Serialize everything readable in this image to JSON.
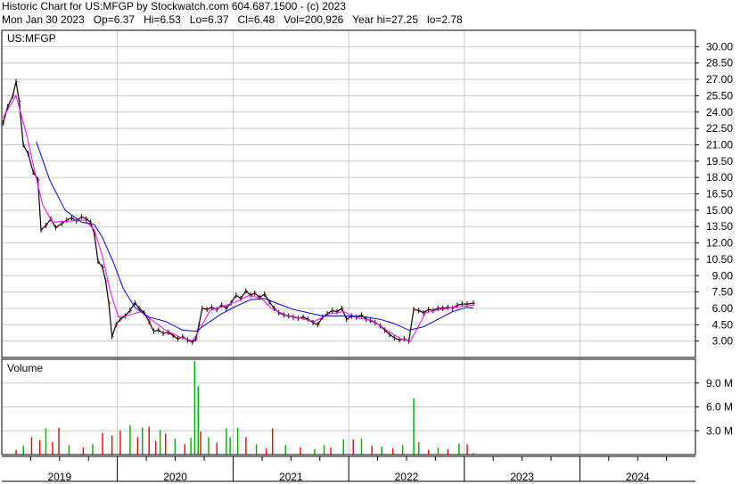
{
  "header": {
    "line1": "Historic Chart for US:MFGP by Stockwatch.com 604.687.1500 - (c) 2023",
    "line2": "Mon Jan 30 2023   Op=6.37   Hi=6.53   Lo=6.37   Cl=6.48   Vol=200,926   Year hi=27.25   lo=2.78"
  },
  "chart_data": [
    {
      "type": "line",
      "title": "US:MFGP",
      "y_scale": "linear",
      "ylim": [
        1.5,
        31.5
      ],
      "ytick_labels": [
        "30.00",
        "28.50",
        "27.00",
        "25.50",
        "24.00",
        "22.50",
        "21.00",
        "19.50",
        "18.00",
        "16.50",
        "15.00",
        "13.50",
        "12.00",
        "10.50",
        "9.00",
        "7.50",
        "6.00",
        "4.50",
        "3.00"
      ],
      "xlim": [
        "2019-01-01",
        "2024-12-31"
      ],
      "xtick_labels": [
        "2019",
        "2020",
        "2021",
        "2022",
        "2023",
        "2024"
      ],
      "grid": true,
      "colors": {
        "price": "#000000",
        "ma_short": "#ff00ff",
        "ma_long": "#0000cc",
        "grid": "#c8c8c8"
      },
      "series": [
        {
          "style": "price",
          "points": [
            [
              "2019-01-05",
              23.0
            ],
            [
              "2019-01-20",
              24.5
            ],
            [
              "2019-02-05",
              25.5
            ],
            [
              "2019-02-15",
              26.8
            ],
            [
              "2019-02-25",
              25.0
            ],
            [
              "2019-03-10",
              21.0
            ],
            [
              "2019-03-25",
              20.2
            ],
            [
              "2019-04-10",
              18.5
            ],
            [
              "2019-04-25",
              17.8
            ],
            [
              "2019-05-05",
              13.2
            ],
            [
              "2019-05-20",
              13.6
            ],
            [
              "2019-06-05",
              14.2
            ],
            [
              "2019-06-20",
              13.4
            ],
            [
              "2019-07-10",
              13.8
            ],
            [
              "2019-07-25",
              14.1
            ],
            [
              "2019-08-10",
              14.3
            ],
            [
              "2019-08-25",
              14.0
            ],
            [
              "2019-09-10",
              14.4
            ],
            [
              "2019-09-25",
              14.2
            ],
            [
              "2019-10-08",
              13.9
            ],
            [
              "2019-10-20",
              12.9
            ],
            [
              "2019-11-01",
              10.3
            ],
            [
              "2019-11-15",
              9.8
            ],
            [
              "2019-11-25",
              8.5
            ],
            [
              "2019-12-05",
              6.5
            ],
            [
              "2019-12-15",
              3.4
            ],
            [
              "2019-12-28",
              4.5
            ],
            [
              "2020-01-10",
              5.0
            ],
            [
              "2020-01-25",
              5.3
            ],
            [
              "2020-02-10",
              5.8
            ],
            [
              "2020-02-25",
              6.5
            ],
            [
              "2020-03-10",
              6.0
            ],
            [
              "2020-03-25",
              5.6
            ],
            [
              "2020-04-10",
              4.8
            ],
            [
              "2020-04-25",
              3.9
            ],
            [
              "2020-05-10",
              4.0
            ],
            [
              "2020-05-25",
              3.7
            ],
            [
              "2020-06-10",
              3.8
            ],
            [
              "2020-06-25",
              3.5
            ],
            [
              "2020-07-10",
              3.2
            ],
            [
              "2020-07-25",
              3.4
            ],
            [
              "2020-08-10",
              3.1
            ],
            [
              "2020-08-25",
              2.9
            ],
            [
              "2020-09-05",
              3.2
            ],
            [
              "2020-09-15",
              4.5
            ],
            [
              "2020-09-25",
              6.0
            ],
            [
              "2020-10-10",
              5.9
            ],
            [
              "2020-10-25",
              6.1
            ],
            [
              "2020-11-10",
              5.9
            ],
            [
              "2020-11-25",
              6.3
            ],
            [
              "2020-12-10",
              6.0
            ],
            [
              "2020-12-25",
              6.5
            ],
            [
              "2021-01-10",
              7.2
            ],
            [
              "2021-01-25",
              6.9
            ],
            [
              "2021-02-10",
              7.6
            ],
            [
              "2021-02-25",
              7.2
            ],
            [
              "2021-03-10",
              7.4
            ],
            [
              "2021-03-25",
              7.0
            ],
            [
              "2021-04-10",
              7.3
            ],
            [
              "2021-04-25",
              6.6
            ],
            [
              "2021-05-10",
              6.0
            ],
            [
              "2021-05-25",
              5.6
            ],
            [
              "2021-06-10",
              5.4
            ],
            [
              "2021-06-25",
              5.3
            ],
            [
              "2021-07-10",
              5.2
            ],
            [
              "2021-07-25",
              5.1
            ],
            [
              "2021-08-10",
              5.2
            ],
            [
              "2021-08-25",
              5.0
            ],
            [
              "2021-09-10",
              4.7
            ],
            [
              "2021-09-25",
              4.5
            ],
            [
              "2021-10-10",
              5.2
            ],
            [
              "2021-10-25",
              5.5
            ],
            [
              "2021-11-10",
              5.8
            ],
            [
              "2021-11-25",
              5.7
            ],
            [
              "2021-12-10",
              6.0
            ],
            [
              "2021-12-25",
              5.0
            ],
            [
              "2022-01-10",
              5.3
            ],
            [
              "2022-01-25",
              5.2
            ],
            [
              "2022-02-10",
              5.4
            ],
            [
              "2022-02-25",
              5.0
            ],
            [
              "2022-03-10",
              4.9
            ],
            [
              "2022-03-25",
              4.7
            ],
            [
              "2022-04-10",
              4.4
            ],
            [
              "2022-04-25",
              4.0
            ],
            [
              "2022-05-10",
              3.6
            ],
            [
              "2022-05-25",
              3.3
            ],
            [
              "2022-06-10",
              3.1
            ],
            [
              "2022-06-25",
              3.2
            ],
            [
              "2022-07-10",
              3.0
            ],
            [
              "2022-07-25",
              5.9
            ],
            [
              "2022-08-10",
              5.8
            ],
            [
              "2022-08-25",
              5.6
            ],
            [
              "2022-09-10",
              5.9
            ],
            [
              "2022-09-25",
              5.8
            ],
            [
              "2022-10-10",
              6.0
            ],
            [
              "2022-10-25",
              6.0
            ],
            [
              "2022-11-10",
              6.1
            ],
            [
              "2022-11-25",
              6.0
            ],
            [
              "2022-12-10",
              6.3
            ],
            [
              "2022-12-25",
              6.4
            ],
            [
              "2023-01-10",
              6.4
            ],
            [
              "2023-01-30",
              6.48
            ]
          ]
        },
        {
          "style": "ma_short",
          "points": [
            [
              "2019-01-05",
              23.5
            ],
            [
              "2019-02-15",
              25.5
            ],
            [
              "2019-03-20",
              22.0
            ],
            [
              "2019-04-15",
              18.6
            ],
            [
              "2019-05-10",
              15.5
            ],
            [
              "2019-06-10",
              13.9
            ],
            [
              "2019-08-01",
              14.0
            ],
            [
              "2019-09-20",
              14.1
            ],
            [
              "2019-10-20",
              13.2
            ],
            [
              "2019-11-15",
              10.8
            ],
            [
              "2019-12-10",
              7.5
            ],
            [
              "2020-01-05",
              5.2
            ],
            [
              "2020-02-10",
              5.4
            ],
            [
              "2020-03-15",
              5.7
            ],
            [
              "2020-04-20",
              4.9
            ],
            [
              "2020-06-01",
              4.0
            ],
            [
              "2020-07-15",
              3.4
            ],
            [
              "2020-08-25",
              3.0
            ],
            [
              "2020-09-20",
              4.2
            ],
            [
              "2020-10-20",
              5.8
            ],
            [
              "2020-12-01",
              6.2
            ],
            [
              "2021-01-10",
              6.6
            ],
            [
              "2021-02-20",
              7.2
            ],
            [
              "2021-04-01",
              6.9
            ],
            [
              "2021-05-01",
              6.0
            ],
            [
              "2021-06-15",
              5.4
            ],
            [
              "2021-08-01",
              5.1
            ],
            [
              "2021-09-15",
              4.8
            ],
            [
              "2021-11-01",
              5.5
            ],
            [
              "2021-12-15",
              5.7
            ],
            [
              "2022-02-01",
              5.1
            ],
            [
              "2022-03-15",
              4.9
            ],
            [
              "2022-05-01",
              4.0
            ],
            [
              "2022-06-15",
              3.2
            ],
            [
              "2022-07-15",
              3.0
            ],
            [
              "2022-09-01",
              5.6
            ],
            [
              "2022-10-15",
              5.9
            ],
            [
              "2022-12-01",
              6.1
            ],
            [
              "2023-01-30",
              6.3
            ]
          ]
        },
        {
          "style": "ma_long",
          "points": [
            [
              "2019-04-20",
              21.3
            ],
            [
              "2019-06-01",
              17.8
            ],
            [
              "2019-07-20",
              15.0
            ],
            [
              "2019-09-10",
              13.9
            ],
            [
              "2019-10-20",
              13.7
            ],
            [
              "2019-11-15",
              12.5
            ],
            [
              "2019-12-20",
              10.2
            ],
            [
              "2020-01-20",
              7.8
            ],
            [
              "2020-02-25",
              6.1
            ],
            [
              "2020-04-10",
              5.2
            ],
            [
              "2020-06-01",
              4.8
            ],
            [
              "2020-07-25",
              4.0
            ],
            [
              "2020-09-05",
              3.9
            ],
            [
              "2020-10-10",
              4.6
            ],
            [
              "2020-11-25",
              5.5
            ],
            [
              "2021-01-10",
              6.2
            ],
            [
              "2021-02-25",
              6.8
            ],
            [
              "2021-04-10",
              6.9
            ],
            [
              "2021-05-25",
              6.4
            ],
            [
              "2021-07-10",
              5.9
            ],
            [
              "2021-08-25",
              5.6
            ],
            [
              "2021-10-10",
              5.3
            ],
            [
              "2021-11-25",
              5.3
            ],
            [
              "2022-01-10",
              5.3
            ],
            [
              "2022-02-25",
              5.2
            ],
            [
              "2022-04-10",
              5.0
            ],
            [
              "2022-05-25",
              4.6
            ],
            [
              "2022-07-10",
              4.0
            ],
            [
              "2022-08-25",
              4.3
            ],
            [
              "2022-10-10",
              5.0
            ],
            [
              "2022-11-25",
              5.7
            ],
            [
              "2023-01-10",
              6.1
            ],
            [
              "2023-01-30",
              6.0
            ]
          ]
        }
      ]
    },
    {
      "type": "bar",
      "title": "Volume",
      "ylim": [
        0,
        12.0
      ],
      "ytick_labels": [
        "9.0 M",
        "6.0 M",
        "3.0 M"
      ],
      "xlim": [
        "2019-01-01",
        "2024-12-31"
      ],
      "grid": true,
      "colors": {
        "up": "#00aa00",
        "down": "#ee0000"
      },
      "values_millions": [
        [
          "2019-02-15",
          0.6,
          "down"
        ],
        [
          "2019-03-10",
          1.1,
          "up"
        ],
        [
          "2019-04-05",
          2.2,
          "down"
        ],
        [
          "2019-05-01",
          1.8,
          "down"
        ],
        [
          "2019-05-20",
          3.3,
          "up"
        ],
        [
          "2019-06-10",
          1.6,
          "down"
        ],
        [
          "2019-06-30",
          3.4,
          "down"
        ],
        [
          "2019-08-01",
          1.2,
          "up"
        ],
        [
          "2019-09-15",
          0.9,
          "down"
        ],
        [
          "2019-10-15",
          1.3,
          "up"
        ],
        [
          "2019-11-15",
          2.7,
          "down"
        ],
        [
          "2019-12-15",
          2.4,
          "down"
        ],
        [
          "2020-01-10",
          3.0,
          "down"
        ],
        [
          "2020-02-10",
          3.7,
          "up"
        ],
        [
          "2020-03-05",
          2.2,
          "down"
        ],
        [
          "2020-03-20",
          3.4,
          "up"
        ],
        [
          "2020-04-10",
          3.5,
          "down"
        ],
        [
          "2020-05-01",
          1.7,
          "down"
        ],
        [
          "2020-05-15",
          3.1,
          "up"
        ],
        [
          "2020-06-01",
          2.6,
          "down"
        ],
        [
          "2020-07-01",
          2.0,
          "up"
        ],
        [
          "2020-08-01",
          1.3,
          "down"
        ],
        [
          "2020-08-20",
          2.1,
          "up"
        ],
        [
          "2020-09-01",
          11.8,
          "up"
        ],
        [
          "2020-09-12",
          8.6,
          "up"
        ],
        [
          "2020-09-20",
          2.9,
          "down"
        ],
        [
          "2020-10-15",
          2.2,
          "up"
        ],
        [
          "2020-11-10",
          1.5,
          "down"
        ],
        [
          "2020-12-10",
          3.3,
          "up"
        ],
        [
          "2020-12-22",
          2.2,
          "up"
        ],
        [
          "2021-01-15",
          3.4,
          "up"
        ],
        [
          "2021-02-10",
          2.2,
          "down"
        ],
        [
          "2021-03-15",
          1.3,
          "up"
        ],
        [
          "2021-04-15",
          0.8,
          "down"
        ],
        [
          "2021-05-05",
          3.3,
          "down"
        ],
        [
          "2021-06-15",
          1.2,
          "up"
        ],
        [
          "2021-08-01",
          0.9,
          "down"
        ],
        [
          "2021-09-15",
          0.7,
          "up"
        ],
        [
          "2021-10-15",
          1.2,
          "up"
        ],
        [
          "2021-11-05",
          0.9,
          "down"
        ],
        [
          "2021-12-15",
          1.9,
          "up"
        ],
        [
          "2022-01-15",
          1.9,
          "down"
        ],
        [
          "2022-02-10",
          2.0,
          "up"
        ],
        [
          "2022-03-15",
          1.1,
          "down"
        ],
        [
          "2022-04-15",
          1.0,
          "up"
        ],
        [
          "2022-05-20",
          0.8,
          "down"
        ],
        [
          "2022-06-20",
          1.2,
          "up"
        ],
        [
          "2022-07-25",
          7.1,
          "up"
        ],
        [
          "2022-08-10",
          1.6,
          "up"
        ],
        [
          "2022-09-10",
          0.6,
          "down"
        ],
        [
          "2022-10-10",
          0.9,
          "up"
        ],
        [
          "2022-11-10",
          0.7,
          "down"
        ],
        [
          "2022-12-15",
          1.4,
          "up"
        ],
        [
          "2023-01-10",
          1.3,
          "down"
        ],
        [
          "2023-01-30",
          0.2,
          "up"
        ]
      ]
    }
  ]
}
